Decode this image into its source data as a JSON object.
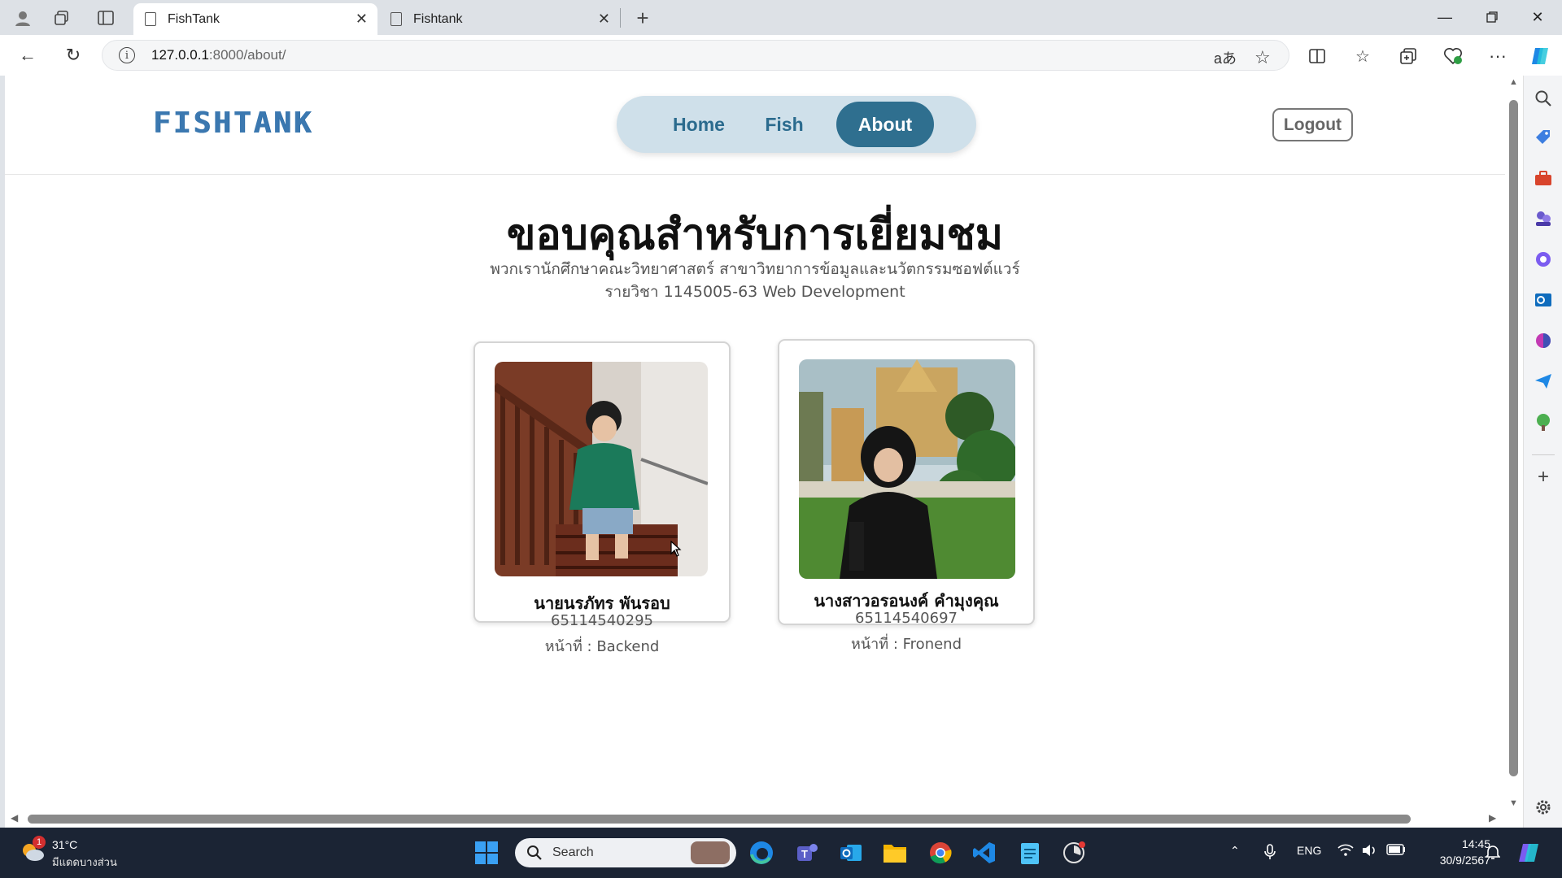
{
  "browser": {
    "tabs": [
      {
        "title": "FishTank",
        "active": true
      },
      {
        "title": "Fishtank",
        "active": false
      }
    ],
    "url_host": "127.0.0.1",
    "url_path": ":8000/about/",
    "translate_glyph": "aあ"
  },
  "site": {
    "logo": "FISHTANK",
    "nav": {
      "home": "Home",
      "fish": "Fish",
      "about": "About"
    },
    "logout": "Logout"
  },
  "about": {
    "title": "ขอบคุณสำหรับการเยี่ยมชม",
    "subtitle_line1": "พวกเรานักศึกษาคณะวิทยาศาสตร์ สาขาวิทยาการข้อมูลและนวัตกรรมซอฟต์แวร์",
    "subtitle_line2": "รายวิชา 1145005-63 Web Development",
    "members": [
      {
        "name": "นายนรภัทร พันรอบ",
        "id": "65114540295",
        "role": "หน้าที่ : Backend"
      },
      {
        "name": "นางสาวอรอนงค์ คำมุงคุณ",
        "id": "65114540697",
        "role": "หน้าที่ : Fronend"
      }
    ]
  },
  "taskbar": {
    "weather_temp": "31°C",
    "weather_desc": "มีแดดบางส่วน",
    "weather_badge": "1",
    "search_placeholder": "Search",
    "lang": "ENG",
    "time": "14:45",
    "date": "30/9/2567"
  }
}
